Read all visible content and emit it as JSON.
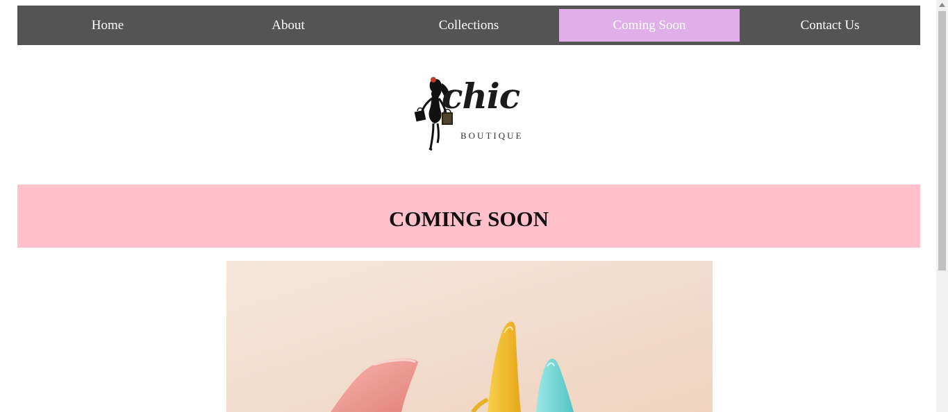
{
  "nav": {
    "items": [
      {
        "label": "Home",
        "active": false
      },
      {
        "label": "About",
        "active": false
      },
      {
        "label": "Collections",
        "active": false
      },
      {
        "label": "Coming Soon",
        "active": true
      },
      {
        "label": "Contact Us",
        "active": false
      }
    ]
  },
  "logo": {
    "brand": "chic",
    "subtitle": "BOUTIQUE"
  },
  "banner": {
    "title": "COMING SOON"
  },
  "hero": {
    "icon": "high-heel-shoes-image"
  },
  "colors": {
    "nav_bg": "#545454",
    "nav_active": "#e0aee8",
    "banner_bg": "#ffbfcb",
    "hero_bg": "#f2ddd0"
  }
}
